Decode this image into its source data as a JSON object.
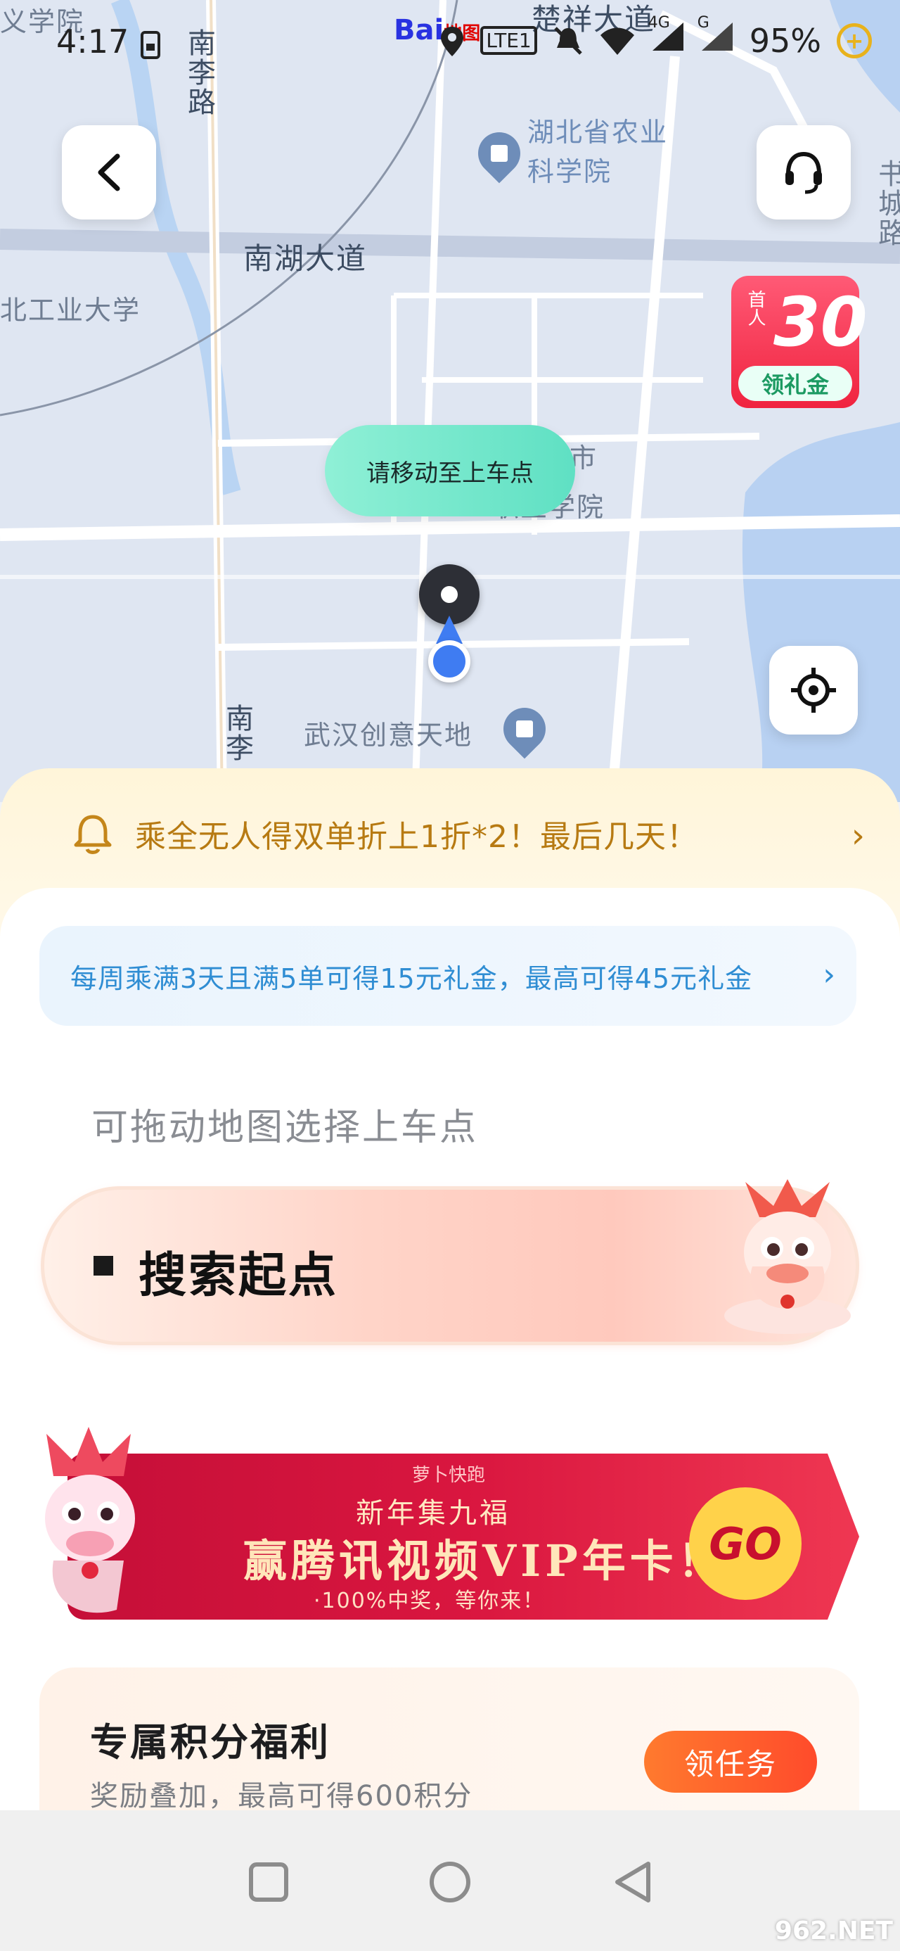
{
  "status_bar": {
    "time": "4:17",
    "network_4g": "4G",
    "network_g": "G",
    "battery": "95%",
    "lte": "LTE1"
  },
  "map": {
    "baidu_logo": "Bai",
    "baidu_logo_suffix": "地图",
    "labels": {
      "top_left": "义学院",
      "top_road": "楚祥大道",
      "nanli_road": "南李路",
      "institute": "湖北省农业\n科学院",
      "nanhu_avenue": "南湖大道",
      "university": "北工业大学",
      "side_right": "书城路",
      "school_1": "武汉市",
      "school_2": "职业学院",
      "nanli_lower": "南李",
      "creative_park": "武汉创意天地"
    },
    "coupon_badge": {
      "first_ride": "首人",
      "amount": "30",
      "tag": "领礼金"
    },
    "move_tip": "请移动至上车点"
  },
  "promo": {
    "text": "乘全无人得双单折上1折*2！最后几天！"
  },
  "weekly": {
    "text": "每周乘满3天且满5单可得15元礼金，最高可得45元礼金"
  },
  "hint": "可拖动地图选择上车点",
  "search": {
    "label": "搜索起点"
  },
  "banner": {
    "brand": "萝卜快跑",
    "line1": "新年集九福",
    "line2": "赢腾讯视频VIP年卡！",
    "line3": "·100%中奖，等你来！",
    "go": "GO"
  },
  "points": {
    "title": "专属积分福利",
    "subtitle": "奖励叠加，最高可得600积分",
    "button": "领任务"
  },
  "watermark": "962.NET"
}
